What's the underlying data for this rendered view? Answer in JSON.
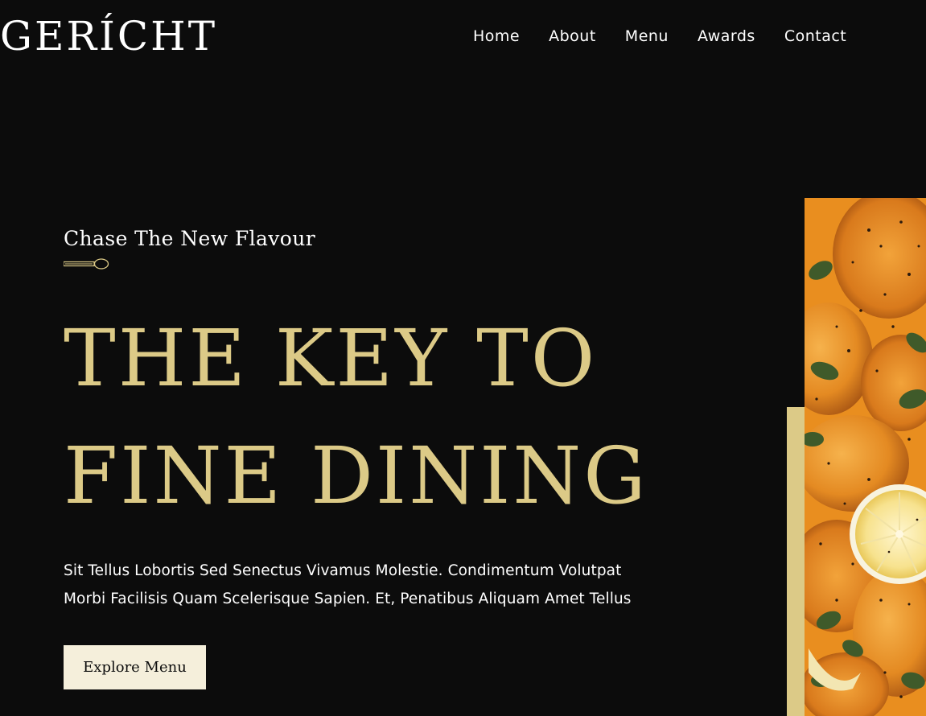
{
  "brand": {
    "logo_text": "GERÍCHT"
  },
  "nav": {
    "items": [
      {
        "label": "Home"
      },
      {
        "label": "About"
      },
      {
        "label": "Menu"
      },
      {
        "label": "Awards"
      },
      {
        "label": "Contact"
      }
    ]
  },
  "hero": {
    "subtitle": "Chase The New Flavour",
    "title_line1": "THE KEY TO",
    "title_line2": "FINE DINING",
    "description_line1": "Sit Tellus Lobortis Sed Senectus Vivamus Molestie. Condimentum Volutpat",
    "description_line2": "Morbi Facilisis Quam Scelerisque Sapien. Et, Penatibus Aliquam Amet Tellus",
    "cta_label": "Explore Menu",
    "image_subject": "roasted salmon with lemon slice and herbs"
  },
  "colors": {
    "background": "#0c0c0c",
    "gold_accent": "#dcca87",
    "button_background": "#f5efdb",
    "text": "#ffffff"
  },
  "icons": {
    "spoon": "spoon-icon"
  }
}
